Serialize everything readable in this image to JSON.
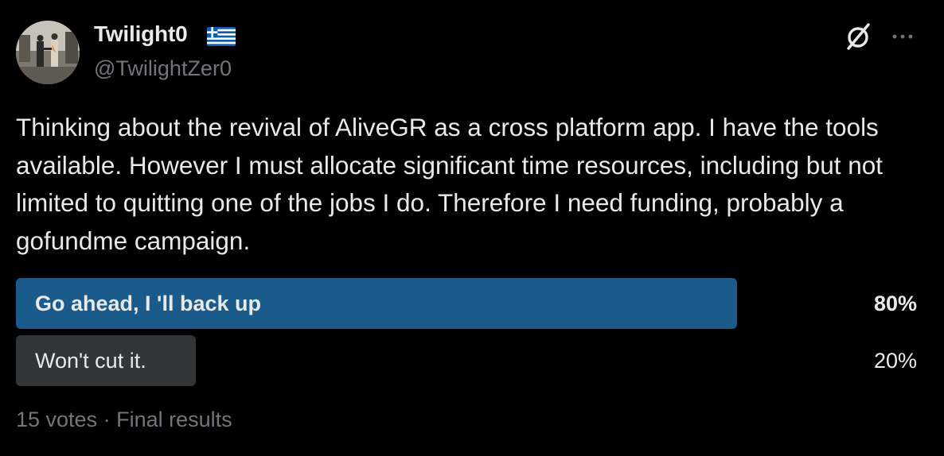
{
  "author": {
    "display_name": "Twilight0",
    "handle": "@TwilightZer0",
    "flag_icon": "greece-flag-icon",
    "avatar_icon": "album-cover-avatar"
  },
  "actions": {
    "grok_icon": "grok-icon",
    "more_icon": "more-horizontal-icon"
  },
  "tweet": {
    "text": "Thinking about the revival of AliveGR as a cross platform app. I have the tools available. However I must allocate significant time resources, including but not limited to quitting one of the jobs I do. Therefore I need funding, probably a gofundme campaign."
  },
  "poll": {
    "options": [
      {
        "label": "Go ahead, I 'll back up",
        "percent_text": "80%",
        "share": 0.8,
        "leading": true
      },
      {
        "label": "Won't cut it.",
        "percent_text": "20%",
        "share": 0.2,
        "leading": false
      }
    ],
    "votes": "15 votes",
    "separator": "·",
    "status": "Final results"
  },
  "colors": {
    "background": "#000000",
    "text": "#e7e9ea",
    "secondary_text": "#71767b",
    "leading_bar": "#1a5b8c",
    "other_bar": "#333639"
  }
}
